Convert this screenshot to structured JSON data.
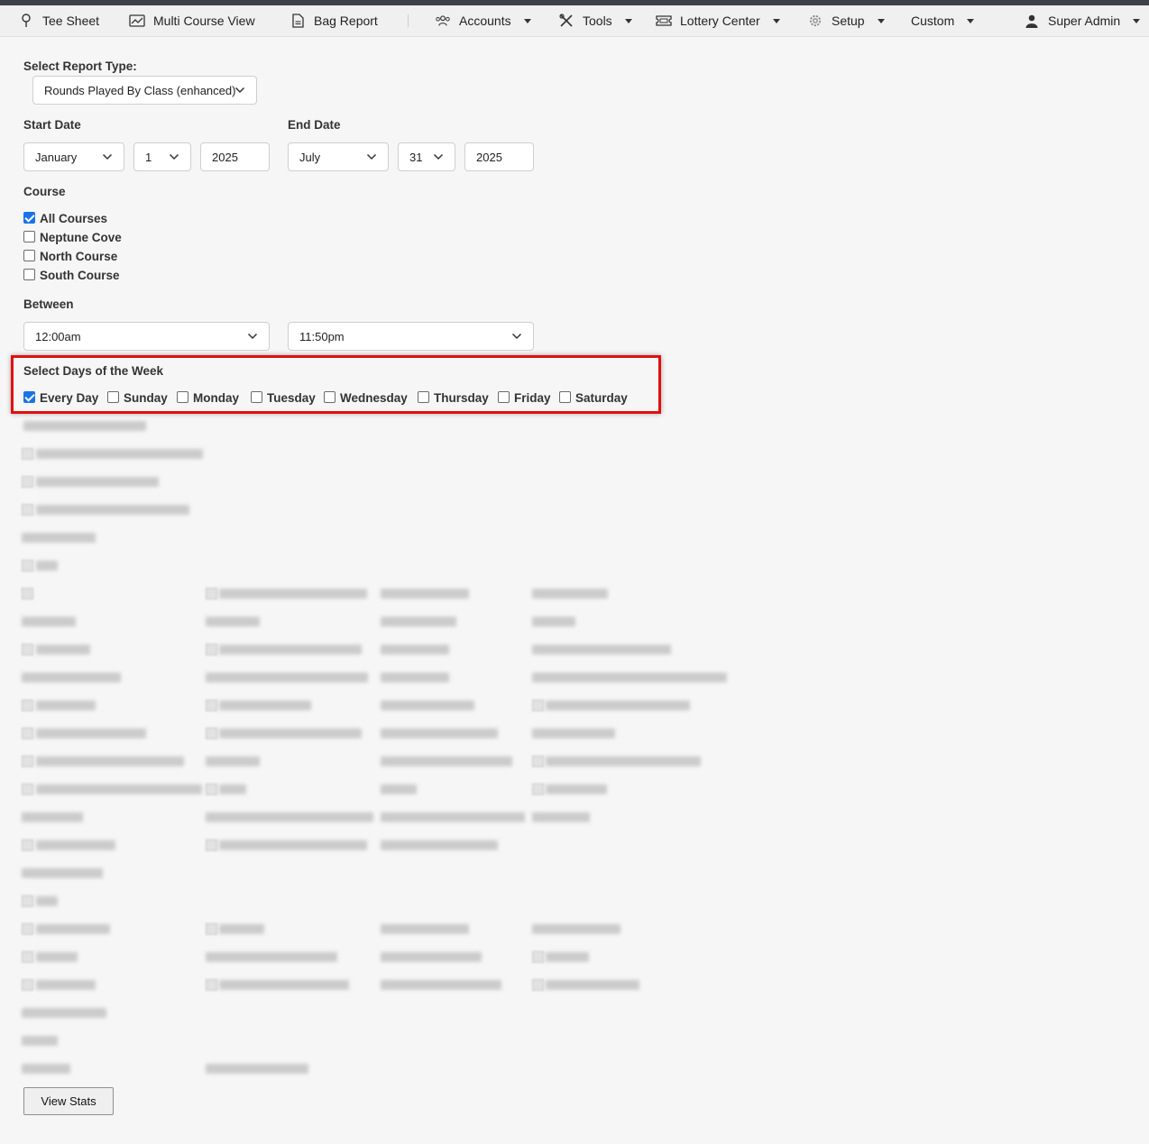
{
  "nav": {
    "tee_sheet": "Tee Sheet",
    "multi_course_view": "Multi Course View",
    "bag_report": "Bag Report",
    "accounts": "Accounts",
    "tools": "Tools",
    "lottery_center": "Lottery Center",
    "setup": "Setup",
    "custom": "Custom",
    "user": "Super Admin"
  },
  "report": {
    "label": "Select Report Type:",
    "value": "Rounds Played By Class (enhanced)"
  },
  "start_date": {
    "label": "Start Date",
    "month": "January",
    "day": "1",
    "year": "2025"
  },
  "end_date": {
    "label": "End Date",
    "month": "July",
    "day": "31",
    "year": "2025"
  },
  "course": {
    "label": "Course",
    "options": [
      {
        "label": "All Courses",
        "checked": true
      },
      {
        "label": "Neptune Cove",
        "checked": false
      },
      {
        "label": "North Course",
        "checked": false
      },
      {
        "label": "South Course",
        "checked": false
      }
    ]
  },
  "between": {
    "label": "Between",
    "from": "12:00am",
    "to": "11:50pm"
  },
  "days": {
    "label": "Select Days of the Week",
    "options": [
      {
        "label": "Every Day",
        "checked": true
      },
      {
        "label": "Sunday",
        "checked": false
      },
      {
        "label": "Monday",
        "checked": false
      },
      {
        "label": "Tuesday",
        "checked": false
      },
      {
        "label": "Wednesday",
        "checked": false
      },
      {
        "label": "Thursday",
        "checked": false
      },
      {
        "label": "Friday",
        "checked": false
      },
      {
        "label": "Saturday",
        "checked": false
      }
    ]
  },
  "actions": {
    "view_stats": "View Stats"
  },
  "colors": {
    "accent": "#1a73e8",
    "highlight": "#e01010",
    "nav_bg": "#f0f0f0",
    "page_bg": "#f6f6f6"
  }
}
